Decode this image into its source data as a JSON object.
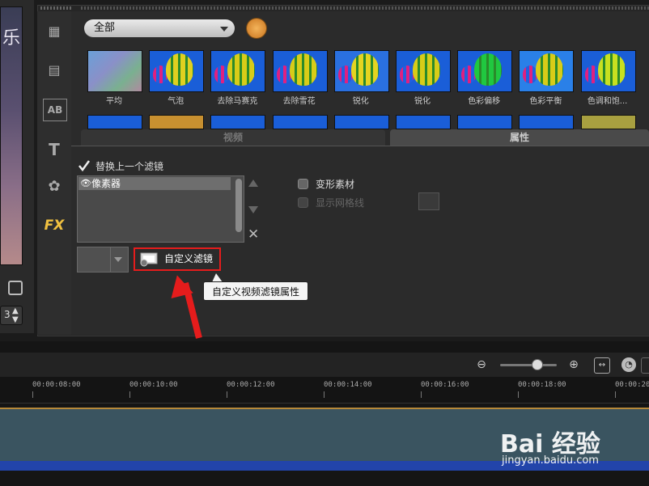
{
  "preview": {
    "title_char": "乐",
    "spin_value": "3"
  },
  "category": {
    "selected": "全部"
  },
  "thumbnails_row1": [
    "平均",
    "气泡",
    "去除马赛克",
    "去除雪花",
    "锐化",
    "锐化",
    "色彩偏移",
    "色彩平衡",
    "色调和饱..."
  ],
  "tabs": {
    "video": "视频",
    "attributes": "属性"
  },
  "options": {
    "replace_last": "替换上一个滤镜",
    "deform": "变形素材",
    "show_grid": "显示网格线"
  },
  "filter_list": [
    "像素器"
  ],
  "custom_filter": {
    "label": "自定义滤镜",
    "tooltip": "自定义视频滤镜属性"
  },
  "ruler_ticks": [
    "00:00:08:00",
    "00:00:10:00",
    "00:00:12:00",
    "00:00:14:00",
    "00:00:16:00",
    "00:00:18:00",
    "00:00:20"
  ],
  "watermark": {
    "brand": "Bai 经验",
    "url": "jingyan.baidu.com"
  },
  "colors": {
    "highlight": "#e51c1c",
    "accent": "#f0a030"
  }
}
